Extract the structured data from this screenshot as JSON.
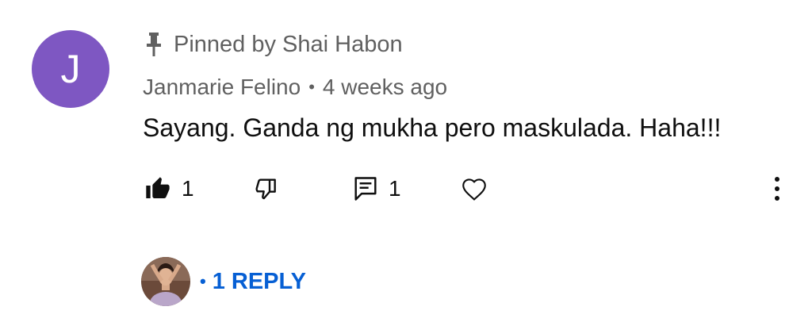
{
  "comment": {
    "avatar_letter": "J",
    "avatar_color": "#7e57c2",
    "pinned_label": "Pinned by Shai Habon",
    "author": "Janmarie Felino",
    "separator": "•",
    "timestamp": "4 weeks ago",
    "text": "Sayang. Ganda ng mukha pero maskulada. Haha!!!",
    "likes": "1",
    "reply_count": "1",
    "icons": {
      "pin": "pin-icon",
      "like": "thumbs-up-filled-icon",
      "dislike": "thumbs-down-icon",
      "reply": "comment-icon",
      "heart": "heart-icon",
      "more": "more-vertical-icon"
    }
  },
  "replies": {
    "bullet": "•",
    "label": "1 REPLY",
    "link_color": "#065fd4"
  }
}
